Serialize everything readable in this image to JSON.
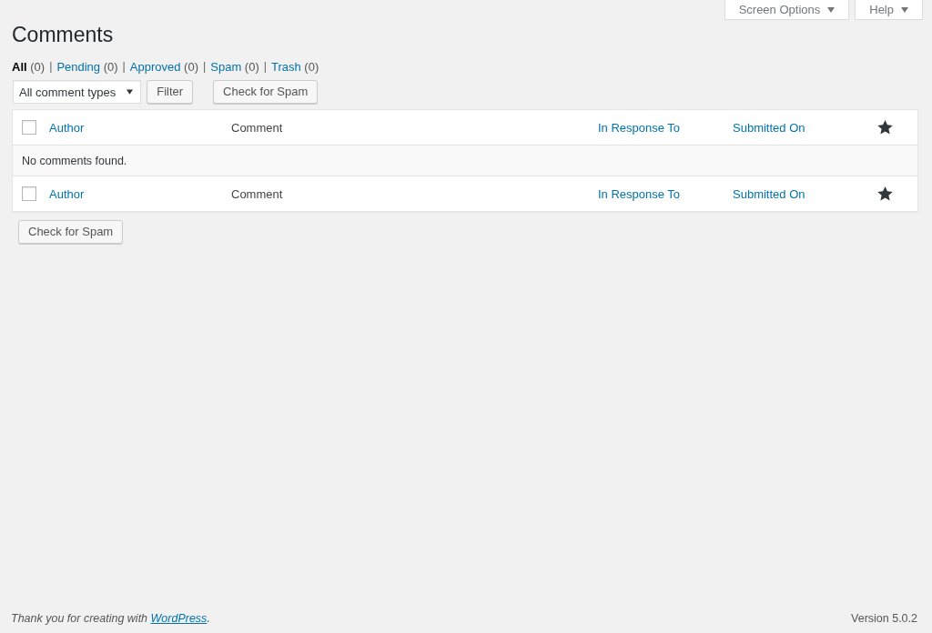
{
  "screen_meta": [
    {
      "label": "Screen Options",
      "expanded": false
    },
    {
      "label": "Help",
      "expanded": false
    }
  ],
  "page_title": "Comments",
  "status_filters": [
    {
      "label": "All",
      "count": "(0)",
      "selected": true
    },
    {
      "separator": "|",
      "label": "Pending",
      "count": "(0)",
      "selected": false
    },
    {
      "separator": "|",
      "label": "Approved",
      "count": "(0)",
      "selected": false
    },
    {
      "separator": "|",
      "label": "Spam",
      "count": "(0)",
      "selected": false
    },
    {
      "separator": "|",
      "label": "Trash",
      "count": "(0)",
      "selected": false
    }
  ],
  "type_filter": {
    "value": "All comment types"
  },
  "filter_button": "Filter",
  "top_spam_button": "Check for Spam",
  "table": {
    "header": [
      {
        "kind": "checkbox",
        "checked": false
      },
      {
        "kind": "link",
        "label": "Author"
      },
      {
        "kind": "text",
        "label": "Comment"
      },
      {
        "kind": "link",
        "label": "In Response To"
      },
      {
        "kind": "link",
        "label": "Submitted On"
      },
      {
        "kind": "star"
      }
    ],
    "empty_message": "No comments found.",
    "footer": [
      {
        "kind": "checkbox",
        "checked": false
      },
      {
        "kind": "link",
        "label": "Author"
      },
      {
        "kind": "text",
        "label": "Comment"
      },
      {
        "kind": "link",
        "label": "In Response To"
      },
      {
        "kind": "link",
        "label": "Submitted On"
      },
      {
        "kind": "star"
      }
    ]
  },
  "bottom_spam_button": "Check for Spam",
  "footer": {
    "thanks_before": "Thank you for creating with ",
    "link": "WordPress",
    "thanks_after": ".",
    "version": "Version 5.0.2"
  }
}
